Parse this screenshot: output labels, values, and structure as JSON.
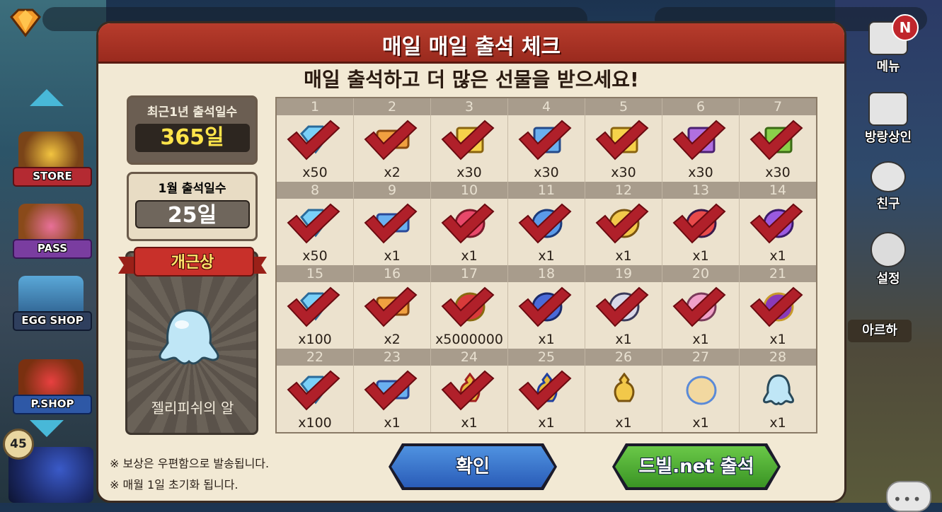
{
  "side_menu": {
    "store_label": "STORE",
    "pass_label": "PASS",
    "egg_shop_label": "EGG SHOP",
    "p_shop_label": "P.SHOP",
    "level": "45"
  },
  "right_menu": {
    "menu_label": "메뉴",
    "notification_badge": "N",
    "merchant_label": "방랑상인",
    "friends_label": "친구",
    "settings_label": "설정",
    "character_name": "아르하"
  },
  "dialog": {
    "title": "매일 매일 출석 체크",
    "subtitle": "매일 출석하고 더 많은 선물을 받으세요!",
    "yearly_label": "최근1년 출석일수",
    "yearly_value": "365일",
    "monthly_label": "1월 출석일수",
    "monthly_value": "25일",
    "perfect_label": "개근상",
    "perfect_reward_name": "젤리피쉬의 알",
    "note1": "※ 보상은 우편함으로 발송됩니다.",
    "note2": "※ 매월 1일 초기화 됩니다.",
    "confirm_button": "확인",
    "dvil_button": "드빌.net 출석"
  },
  "days": [
    {
      "day": "1",
      "qty": "x50",
      "item": "diamond-icon",
      "checked": true
    },
    {
      "day": "2",
      "qty": "x2",
      "item": "ticket-orange-icon",
      "checked": true
    },
    {
      "day": "3",
      "qty": "x30",
      "item": "scroll-gold-icon",
      "checked": true
    },
    {
      "day": "4",
      "qty": "x30",
      "item": "scroll-blue-icon",
      "checked": true
    },
    {
      "day": "5",
      "qty": "x30",
      "item": "scroll-gold-icon",
      "checked": true
    },
    {
      "day": "6",
      "qty": "x30",
      "item": "scroll-purple-icon",
      "checked": true
    },
    {
      "day": "7",
      "qty": "x30",
      "item": "scroll-green-icon",
      "checked": true
    },
    {
      "day": "8",
      "qty": "x50",
      "item": "diamond-icon",
      "checked": true
    },
    {
      "day": "9",
      "qty": "x1",
      "item": "ticket-blue-icon",
      "checked": true
    },
    {
      "day": "10",
      "qty": "x1",
      "item": "wing-red-icon",
      "checked": true
    },
    {
      "day": "11",
      "qty": "x1",
      "item": "wing-blue-icon",
      "checked": true
    },
    {
      "day": "12",
      "qty": "x1",
      "item": "wing-gold-icon",
      "checked": true
    },
    {
      "day": "13",
      "qty": "x1",
      "item": "rainbow-gem-icon",
      "checked": true
    },
    {
      "day": "14",
      "qty": "x1",
      "item": "purple-crystal-icon",
      "checked": true
    },
    {
      "day": "15",
      "qty": "x100",
      "item": "diamond-icon",
      "checked": true
    },
    {
      "day": "16",
      "qty": "x2",
      "item": "ticket-orange-icon",
      "checked": true
    },
    {
      "day": "17",
      "qty": "x5000000",
      "item": "treasure-chest-icon",
      "checked": true
    },
    {
      "day": "18",
      "qty": "x1",
      "item": "key-blue-icon",
      "checked": true
    },
    {
      "day": "19",
      "qty": "x1",
      "item": "dragon-figure-icon",
      "checked": true
    },
    {
      "day": "20",
      "qty": "x1",
      "item": "pink-egg-icon",
      "checked": true
    },
    {
      "day": "21",
      "qty": "x1",
      "item": "purple-egg-icon",
      "checked": true
    },
    {
      "day": "22",
      "qty": "x100",
      "item": "diamond-icon",
      "checked": true
    },
    {
      "day": "23",
      "qty": "x1",
      "item": "ticket-blue-icon",
      "checked": true
    },
    {
      "day": "24",
      "qty": "x1",
      "item": "golden-urn-red-icon",
      "checked": true
    },
    {
      "day": "25",
      "qty": "x1",
      "item": "golden-urn-blue-icon",
      "checked": true
    },
    {
      "day": "26",
      "qty": "x1",
      "item": "golden-urn-icon",
      "checked": false
    },
    {
      "day": "27",
      "qty": "x1",
      "item": "crown-egg-icon",
      "checked": false
    },
    {
      "day": "28",
      "qty": "x1",
      "item": "jellyfish-egg-icon",
      "checked": false
    }
  ],
  "colors": {
    "header_red": "#b73c2c",
    "check_red": "#b0202a",
    "confirm_blue": "#2a5cb8",
    "dvil_green": "#3a9424",
    "highlight_yellow": "#ffe44a"
  }
}
